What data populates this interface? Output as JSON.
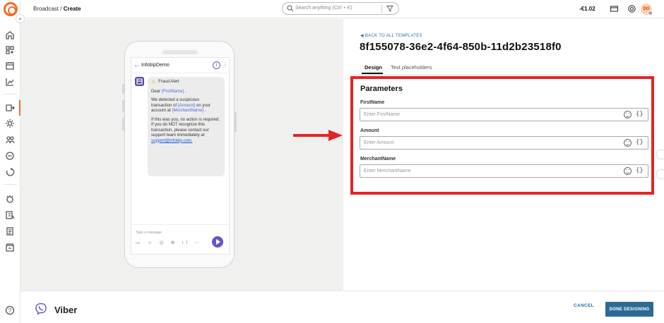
{
  "rail": {
    "expand_glyph": "»",
    "icons": [
      "home-icon",
      "apps-icon",
      "campaigns-icon",
      "analytics-icon",
      "broadcast-icon",
      "settings-icon",
      "people-icon",
      "conversations-icon",
      "flows-icon",
      "integrations-icon",
      "reports-icon",
      "logs-icon",
      "store-icon",
      "help-icon"
    ],
    "help_glyph": "?"
  },
  "topbar": {
    "breadcrumb_parent": "Broadcast / ",
    "breadcrumb_current": "Create",
    "search_placeholder": "Search anything (Ctrl + K)",
    "balance": "-€1.02",
    "avatar_initials": "DG"
  },
  "preview": {
    "back_glyph": "←",
    "sender": "InfobipDemo",
    "info_glyph": "i",
    "more_glyph": "⋮",
    "message": {
      "alert_icon": "⚠",
      "title": "Fraud Alert",
      "dear": "Dear ",
      "first_name_placeholder": "{FirstName}",
      "comma": " ,",
      "p1_a": "We detected a suspicious transaction of ",
      "amount_placeholder": "{Amount}",
      "p1_b": " on your account at ",
      "merchant_placeholder": "{MerchantName}",
      "p1_c": " .",
      "p2": "If this was you, no action is required.",
      "p3_a": "If you do NOT recognize this transaction, please contact our support team immediately at ",
      "email": "support@infobip.com."
    },
    "compose_placeholder": "Type a message",
    "compose_tools": "▭ ☺ ◎ ⊕ ıl ⋯"
  },
  "panel": {
    "back_link": "◀  BACK TO ALL TEMPLATES",
    "template_id": "8f155078-36e2-4f64-850b-11d2b23518f0",
    "tabs": [
      "Design",
      "Test placeholders"
    ],
    "parameters_title": "Parameters",
    "fields": [
      {
        "label": "FirstName",
        "placeholder": "Enter FirstName",
        "value": ""
      },
      {
        "label": "Amount",
        "placeholder": "Enter Amount",
        "value": ""
      },
      {
        "label": "MerchantName",
        "placeholder": "Enter MerchantName",
        "value": ""
      }
    ],
    "braces_glyph": "{}"
  },
  "footer": {
    "channel": "Viber",
    "cancel": "CANCEL",
    "done": "DONE DESIGNING"
  },
  "colors": {
    "accent_orange": "#f26b2a",
    "highlight_red": "#e32525",
    "primary_blue": "#2c6a95",
    "viber_purple": "#7059c9"
  }
}
